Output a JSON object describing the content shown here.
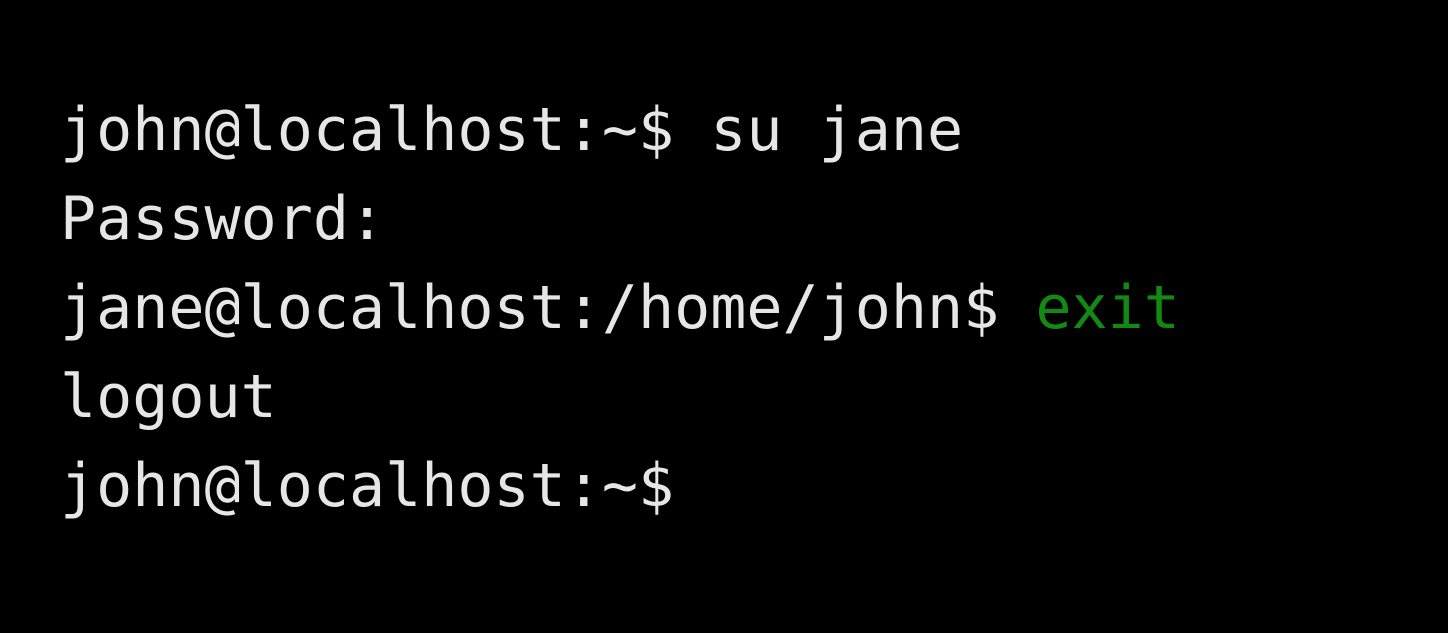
{
  "terminal": {
    "colors": {
      "background": "#000000",
      "foreground": "#e6e6e6",
      "highlight": "#128a12"
    },
    "lines": [
      {
        "prompt": "john@localhost:~$",
        "command": "su jane"
      },
      {
        "text": "Password:"
      },
      {
        "prompt": "jane@localhost:/home/john$",
        "command": "exit"
      },
      {
        "text": "logout"
      },
      {
        "prompt": "john@localhost:~$"
      }
    ]
  }
}
